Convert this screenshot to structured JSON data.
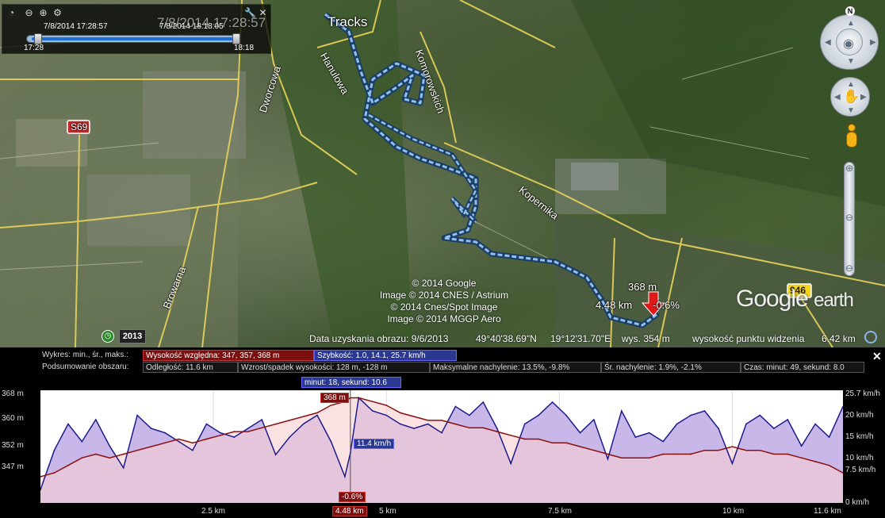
{
  "time_slider": {
    "start_datetime": "7/8/2014  17:28:57",
    "end_datetime": "7/8/2014  18:18:05",
    "current_time": "7/8/2014  17:28:57",
    "min_label": "17:28",
    "max_label": "18:18"
  },
  "map": {
    "places": {
      "tracks": "Tracks",
      "hanulowa": "Hanulowa",
      "komorowskich": "Komorowskich",
      "dworcowa": "Dworcowa",
      "kopernika": "Kopernika",
      "browarna": "Browarna",
      "s69": "S69",
      "r946": "946"
    },
    "marker": {
      "elevation": "368 m",
      "distance": "4.48 km",
      "slope": "-0.6%"
    },
    "credits": [
      "© 2014 Google",
      "Image © 2014 CNES / Astrium",
      "© 2014 Cnes/Spot Image",
      "Image © 2014 MGGP Aero"
    ],
    "logo_brand": "Google",
    "logo_product": "earth",
    "year": "2013"
  },
  "status": {
    "imagery_date": "Data uzyskania obrazu: 9/6/2013",
    "latitude": "49°40'38.69\"N",
    "longitude": "19°12'31.70\"E",
    "elevation": "wys.  354 m",
    "eye_alt_label": "wysokość punktu widzenia",
    "eye_alt_value": "6.42 km"
  },
  "profile": {
    "row1": {
      "label": "Wykres: min., śr., maks.:",
      "elev": "Wysokość względna: 347, 357, 368 m",
      "speed": "Szybkość: 1.0, 14.1, 25.7 km/h"
    },
    "row2": {
      "label": "Podsumowanie obszaru:",
      "distance": "Odległość: 11.6 km",
      "gain": "Wzrost/spadek wysokości: 128 m, -128 m",
      "max_slope": "Maksymalne nachylenie: 13.5%, -9.8%",
      "avg_slope": "Śr. nachylenie: 1.9%, -2.1%",
      "time": "Czas: minut: 49, sekund: 8.0"
    },
    "cursor": {
      "time": "minut: 18, sekund: 10.6",
      "elevation": "368 m",
      "speed": "11.4 km/h",
      "slope": "-0.6%",
      "distance": "4.48 km"
    },
    "colors": {
      "elevation": "#8a1010",
      "speed": "#1c1c8c",
      "elev_fill": "#f6cfd0",
      "speed_fill": "#c9b7ea"
    }
  },
  "chart_data": {
    "type": "line",
    "xlabel": "",
    "ylabel_left": "",
    "ylabel_right": "",
    "x_ticks": [
      "2.5 km",
      "5 km",
      "7.5 km",
      "10 km",
      "11.6 km"
    ],
    "y_left_ticks": [
      "368 m",
      "360 m",
      "352 m",
      "347 m"
    ],
    "y_right_ticks": [
      "25.7 km/h",
      "20 km/h",
      "15 km/h",
      "10 km/h",
      "7.5 km/h",
      "0 km/h"
    ],
    "xlim": [
      0,
      11.6
    ],
    "ylim_left": [
      340,
      370
    ],
    "ylim_right": [
      0,
      25.7
    ],
    "series": [
      {
        "name": "Wysokość względna",
        "axis": "left",
        "x": [
          0,
          0.2,
          0.4,
          0.6,
          0.8,
          1.0,
          1.2,
          1.4,
          1.6,
          1.8,
          2.0,
          2.2,
          2.4,
          2.6,
          2.8,
          3.0,
          3.2,
          3.4,
          3.6,
          3.8,
          4.0,
          4.2,
          4.4,
          4.48,
          4.6,
          4.8,
          5.0,
          5.2,
          5.4,
          5.6,
          5.8,
          6.0,
          6.2,
          6.4,
          6.6,
          6.8,
          7.0,
          7.2,
          7.4,
          7.6,
          7.8,
          8.0,
          8.2,
          8.4,
          8.6,
          8.8,
          9.0,
          9.2,
          9.4,
          9.6,
          9.8,
          10.0,
          10.2,
          10.4,
          10.6,
          10.8,
          11.0,
          11.2,
          11.4,
          11.6
        ],
        "values": [
          347,
          348,
          350,
          352,
          353,
          352,
          353,
          354,
          355,
          356,
          357,
          356,
          357,
          358,
          359,
          359,
          360,
          361,
          362,
          363,
          364,
          366,
          367,
          368,
          368,
          367,
          366,
          364,
          363,
          362,
          362,
          361,
          360,
          360,
          359,
          358,
          357,
          357,
          356,
          356,
          355,
          354,
          353,
          352,
          352,
          352,
          353,
          353,
          353,
          354,
          354,
          355,
          354,
          354,
          353,
          353,
          352,
          351,
          350,
          348
        ]
      },
      {
        "name": "Szybkość",
        "axis": "right",
        "x": [
          0,
          0.2,
          0.4,
          0.6,
          0.8,
          1.0,
          1.2,
          1.4,
          1.6,
          1.8,
          2.0,
          2.2,
          2.4,
          2.6,
          2.8,
          3.0,
          3.2,
          3.4,
          3.6,
          3.8,
          4.0,
          4.2,
          4.4,
          4.48,
          4.6,
          4.8,
          5.0,
          5.2,
          5.4,
          5.6,
          5.8,
          6.0,
          6.2,
          6.4,
          6.6,
          6.8,
          7.0,
          7.2,
          7.4,
          7.6,
          7.8,
          8.0,
          8.2,
          8.4,
          8.6,
          8.8,
          9.0,
          9.2,
          9.4,
          9.6,
          9.8,
          10.0,
          10.2,
          10.4,
          10.6,
          10.8,
          11.0,
          11.2,
          11.4,
          11.6
        ],
        "values": [
          3,
          12,
          18,
          14,
          19,
          13,
          8,
          20,
          17,
          16,
          14,
          12,
          18,
          16,
          15,
          17,
          19,
          11,
          15,
          18,
          20,
          14,
          6,
          11.4,
          24,
          21,
          20,
          18,
          17,
          18,
          16,
          22,
          20,
          23,
          17,
          9,
          18,
          20,
          23,
          20,
          16,
          19,
          10,
          21,
          15,
          16,
          14,
          18,
          20,
          21,
          17,
          9,
          18,
          20,
          17,
          19,
          13,
          18,
          15,
          22
        ]
      }
    ]
  }
}
